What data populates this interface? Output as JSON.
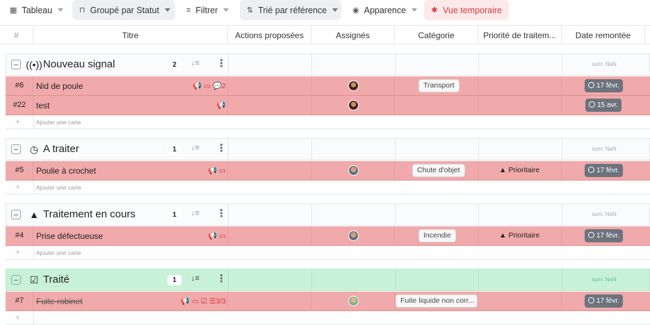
{
  "toolbar": {
    "table_icon": "table-icon",
    "table_label": "Tableau",
    "group_icon": "tray-icon",
    "group_label": "Groupé par Statut",
    "filter_icon": "filter-icon",
    "filter_label": "Filtrer",
    "sort_icon": "sort-icon",
    "sort_label": "Trié par référence",
    "appearance_icon": "eye-icon",
    "appearance_label": "Apparence",
    "temp_icon": "asterisk-icon",
    "temp_label": "Vue temporaire"
  },
  "columns": {
    "num": "#",
    "title": "Titre",
    "actions": "Actions proposées",
    "assignees": "Assignés",
    "category": "Catégorie",
    "priority": "Priorité de traitem...",
    "date": "Date remontée"
  },
  "add_card_label": "Ajouter une carte",
  "groups": [
    {
      "title": "Nouveau signal",
      "icon": "radio-signal-icon",
      "count": "2",
      "sum": "sum: NaN",
      "rows": [
        {
          "id": "#6",
          "title": "Nid de poule",
          "icons": "📢 ▭ 💬2",
          "category": "Transport",
          "priority": "",
          "date": "17 févr."
        },
        {
          "id": "#22",
          "title": "test",
          "icons": "📢",
          "category": "",
          "priority": "",
          "date": "15 avr."
        }
      ]
    },
    {
      "title": "A traiter",
      "icon": "clock-icon",
      "count": "1",
      "sum": "sum: NaN",
      "rows": [
        {
          "id": "#5",
          "title": "Poulie à crochet",
          "icons": "📢 ▭",
          "category": "Chute d'objet",
          "priority": "Prioritaire",
          "date": "17 févr."
        }
      ]
    },
    {
      "title": "Traitement en cours",
      "icon": "road-icon",
      "count": "1",
      "sum": "sum: NaN",
      "rows": [
        {
          "id": "#4",
          "title": "Prise défectueuse",
          "icons": "📢 ▭",
          "category": "Incendie",
          "priority": "Prioritaire",
          "date": "17 févr."
        }
      ]
    },
    {
      "title": "Traité",
      "icon": "checkbox-icon",
      "count": "1",
      "sum": "sum: NaN",
      "rows": [
        {
          "id": "#7",
          "title": "Fuite robinet",
          "icons": "📢 ▭ ☑ ☰3/3",
          "category": "Fuite liquide non corr...",
          "priority": "",
          "date": "17 févr."
        }
      ]
    }
  ],
  "colors": {
    "row_bg": "#f0aaab",
    "done_group_bg": "#c8f2d8",
    "accent_red": "#d9363e",
    "date_badge": "#6c737d"
  }
}
